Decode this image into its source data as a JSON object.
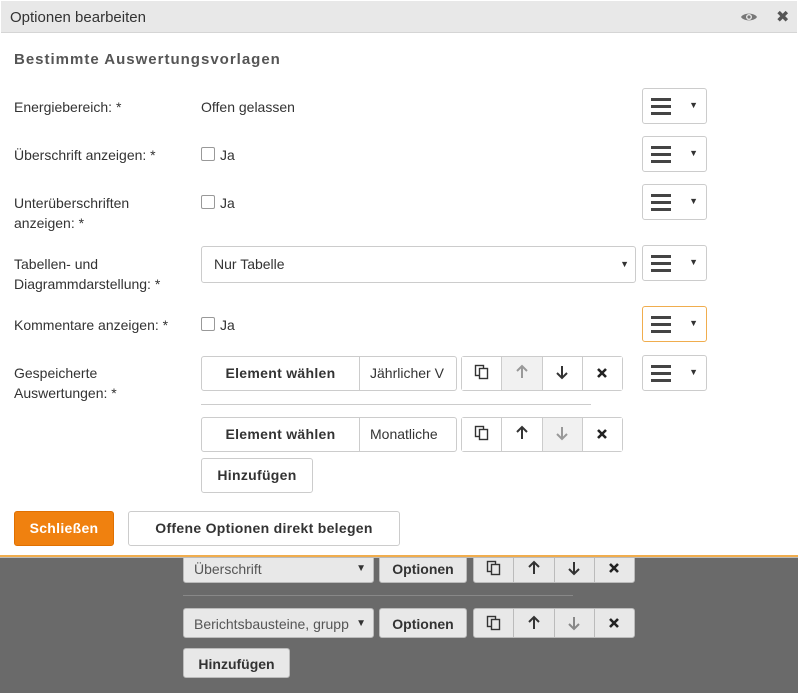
{
  "background": {
    "rows": [
      {
        "select": "Überschrift",
        "button": "Optionen"
      },
      {
        "select": "Berichtsbausteine, grupp",
        "button": "Optionen"
      }
    ],
    "add_label": "Hinzufügen"
  },
  "dialog": {
    "title": "Optionen bearbeiten",
    "section_title": "Bestimmte Auswertungsvorlagen",
    "fields": {
      "energy": {
        "label": "Energiebereich: *",
        "value": "Offen gelassen"
      },
      "heading": {
        "label": "Überschrift anzeigen: *",
        "checkbox": "Ja"
      },
      "subheading": {
        "label_line1": "Unterüberschriften",
        "label_line2": "anzeigen: *",
        "checkbox": "Ja"
      },
      "table": {
        "label_line1": "Tabellen- und",
        "label_line2": "Diagrammdarstellung: *",
        "value": "Nur Tabelle"
      },
      "comments": {
        "label": "Kommentare anzeigen: *",
        "checkbox": "Ja"
      },
      "saved": {
        "label_line1": "Gespeicherte",
        "label_line2": "Auswertungen: *",
        "items": [
          {
            "button": "Element wählen",
            "value": "Jährlicher V"
          },
          {
            "button": "Element wählen",
            "value": "Monatliche"
          }
        ],
        "add_label": "Hinzufügen"
      }
    },
    "footer": {
      "close_label": "Schließen",
      "assign_label": "Offene Optionen direkt belegen"
    },
    "colors": {
      "accent": "#f0810f",
      "active_border": "#f0ad4e"
    }
  }
}
